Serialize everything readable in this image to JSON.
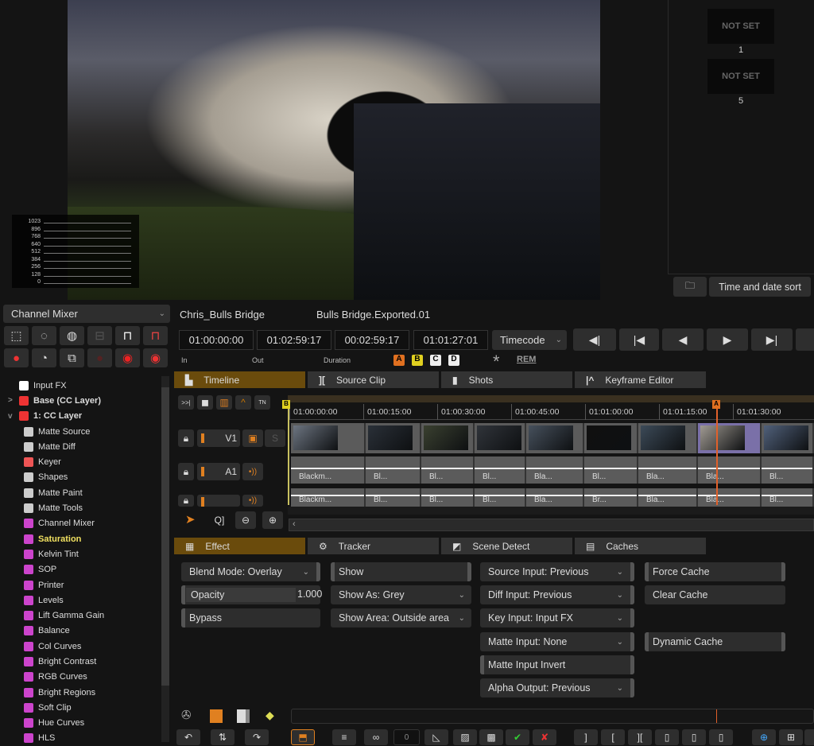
{
  "viewer": {
    "scope_labels": [
      "1023",
      "896",
      "768",
      "640",
      "512",
      "384",
      "256",
      "128",
      "0"
    ]
  },
  "bins": {
    "slots": [
      {
        "label": "NOT SET",
        "number": "1"
      },
      {
        "label": "NOT SET",
        "number": "5"
      }
    ],
    "sort_label": "Time and date sort"
  },
  "effect_select": "Channel Mixer",
  "tree": [
    {
      "label": "Input FX",
      "color": "#fff",
      "indent": 1
    },
    {
      "label": "Base (CC Layer)",
      "color": "#e33",
      "indent": 1,
      "bold": true,
      "expander": ">"
    },
    {
      "label": "1: CC Layer",
      "color": "#e33",
      "indent": 1,
      "bold": true,
      "expander": "v"
    },
    {
      "label": "Matte Source",
      "color": "#ccc",
      "indent": 2
    },
    {
      "label": "Matte Diff",
      "color": "#ccc",
      "indent": 2
    },
    {
      "label": "Keyer",
      "color": "#e55",
      "indent": 2
    },
    {
      "label": "Shapes",
      "color": "#ccc",
      "indent": 2
    },
    {
      "label": "Matte Paint",
      "color": "#ccc",
      "indent": 2
    },
    {
      "label": "Matte Tools",
      "color": "#ccc",
      "indent": 2
    },
    {
      "label": "Channel Mixer",
      "color": "#c4c",
      "indent": 2
    },
    {
      "label": "Saturation",
      "color": "#c4c",
      "indent": 2,
      "bold": true,
      "highlight": true
    },
    {
      "label": "Kelvin Tint",
      "color": "#c4c",
      "indent": 2
    },
    {
      "label": "SOP",
      "color": "#c4c",
      "indent": 2
    },
    {
      "label": "Printer",
      "color": "#c4c",
      "indent": 2
    },
    {
      "label": "Levels",
      "color": "#c4c",
      "indent": 2
    },
    {
      "label": "Lift Gamma Gain",
      "color": "#c4c",
      "indent": 2
    },
    {
      "label": "Balance",
      "color": "#c4c",
      "indent": 2
    },
    {
      "label": "Col Curves",
      "color": "#c4c",
      "indent": 2
    },
    {
      "label": "Bright Contrast",
      "color": "#c4c",
      "indent": 2
    },
    {
      "label": "RGB Curves",
      "color": "#c4c",
      "indent": 2
    },
    {
      "label": "Bright Regions",
      "color": "#c4c",
      "indent": 2
    },
    {
      "label": "Soft Clip",
      "color": "#c4c",
      "indent": 2
    },
    {
      "label": "Hue Curves",
      "color": "#c4c",
      "indent": 2
    },
    {
      "label": "HLS",
      "color": "#c4c",
      "indent": 2
    }
  ],
  "header": {
    "project": "Chris_Bulls Bridge",
    "timeline_name": "Bulls Bridge.Exported.01"
  },
  "timecodes": {
    "in": "01:00:00:00",
    "out": "01:02:59:17",
    "duration": "00:02:59:17",
    "current": "01:01:27:01",
    "in_label": "In",
    "out_label": "Out",
    "duration_label": "Duration",
    "mode": "Timecode"
  },
  "markers": [
    "A",
    "B",
    "C",
    "D"
  ],
  "rem_label": "REM",
  "tabs": [
    "Timeline",
    "Source Clip",
    "Shots",
    "Keyframe Editor"
  ],
  "ruler": [
    "01:00:00:00",
    "01:00:15:00",
    "01:00:30:00",
    "01:00:45:00",
    "01:01:00:00",
    "01:01:15:00",
    "01:01:30:00"
  ],
  "tracks": {
    "video": "V1",
    "audio1": "A1",
    "solo": "S",
    "tn": "TN"
  },
  "audio_clips": [
    [
      "Blackm...",
      "Bl...",
      "Bl...",
      "Bl...",
      "Bla...",
      "Bl...",
      "Bla...",
      "Bla...",
      "Bl..."
    ],
    [
      "Blackm...",
      "Bl...",
      "Bl...",
      "Bl...",
      "Bla...",
      "Br...",
      "Bla...",
      "Bla...",
      "Bl..."
    ]
  ],
  "effect_tabs": [
    "Effect",
    "Tracker",
    "Scene Detect",
    "Caches"
  ],
  "controls": {
    "blend_mode": "Blend Mode: Overlay",
    "opacity_label": "Opacity",
    "opacity_value": "1.000",
    "bypass": "Bypass",
    "show": "Show",
    "show_as": "Show As: Grey",
    "show_area": "Show Area: Outside area",
    "source_input": "Source Input: Previous",
    "diff_input": "Diff Input: Previous",
    "key_input": "Key Input: Input FX",
    "matte_input": "Matte Input: None",
    "matte_invert": "Matte Input Invert",
    "alpha_output": "Alpha Output: Previous",
    "force_cache": "Force Cache",
    "clear_cache": "Clear Cache",
    "dynamic_cache": "Dynamic Cache"
  },
  "bottom": {
    "frame_field": "0"
  },
  "colors": {
    "accent": "#6a4b0c",
    "playhead": "#e0602a",
    "marker_a": "#e07020",
    "marker_b": "#e0d020"
  }
}
